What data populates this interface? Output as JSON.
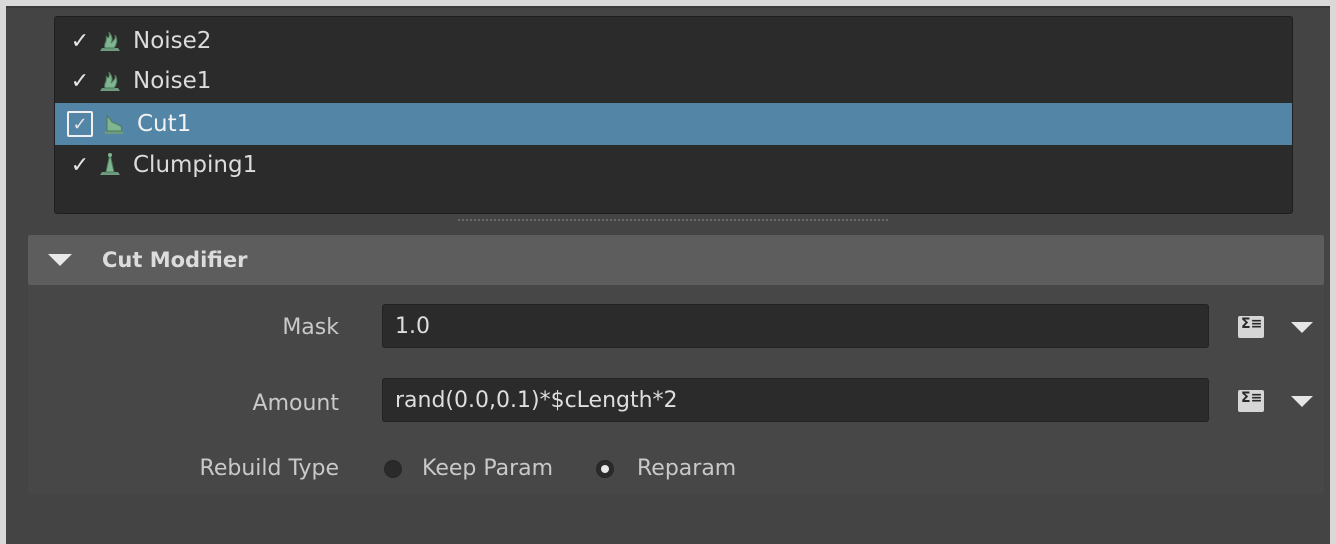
{
  "layers": [
    {
      "label": "Noise2",
      "checked": true,
      "icon": "noise-icon",
      "selected": false
    },
    {
      "label": "Noise1",
      "checked": true,
      "icon": "noise-icon",
      "selected": false
    },
    {
      "label": "Cut1",
      "checked": true,
      "icon": "cut-icon",
      "selected": true
    },
    {
      "label": "Clumping1",
      "checked": true,
      "icon": "clumping-icon",
      "selected": false
    }
  ],
  "section": {
    "title": "Cut Modifier",
    "expanded": true
  },
  "attributes": {
    "mask": {
      "label": "Mask",
      "value": "1.0"
    },
    "amount": {
      "label": "Amount",
      "value": "rand(0.0,0.1)*$cLength*2"
    },
    "rebuild_type": {
      "label": "Rebuild Type",
      "options": [
        "Keep Param",
        "Reparam"
      ],
      "selected": "Reparam"
    }
  },
  "colors": {
    "selection": "#5285a6",
    "panel": "#444444",
    "field": "#2b2b2b",
    "icon_green": "#7fb58f"
  }
}
